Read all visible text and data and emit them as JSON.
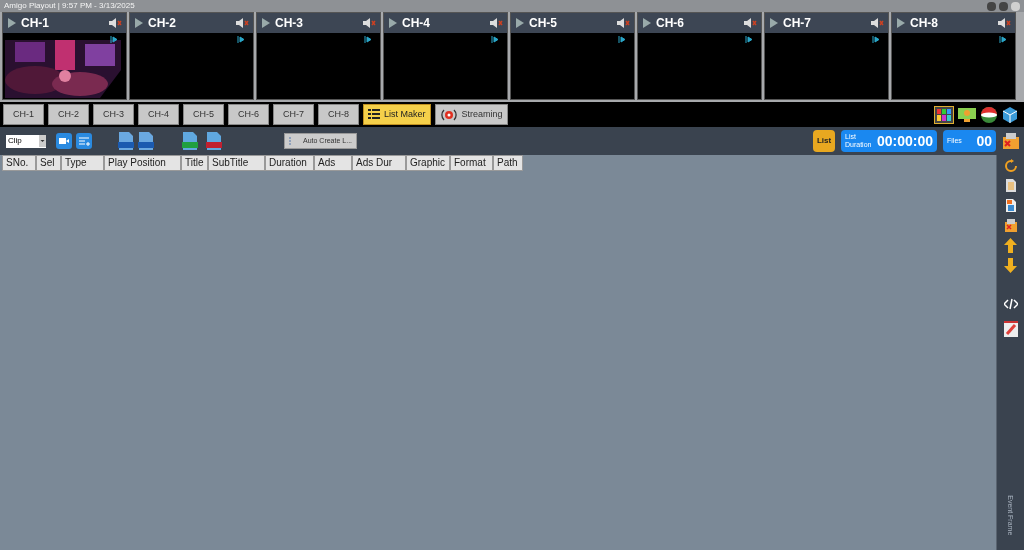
{
  "window": {
    "title": "Amigo Playout | 9:57 PM - 3/13/2025"
  },
  "channels": [
    {
      "label": "CH-1",
      "has_video": true
    },
    {
      "label": "CH-2",
      "has_video": false
    },
    {
      "label": "CH-3",
      "has_video": false
    },
    {
      "label": "CH-4",
      "has_video": false
    },
    {
      "label": "CH-5",
      "has_video": false
    },
    {
      "label": "CH-6",
      "has_video": false
    },
    {
      "label": "CH-7",
      "has_video": false
    },
    {
      "label": "CH-8",
      "has_video": false
    }
  ],
  "tabs": [
    {
      "label": "CH-1",
      "kind": "channel",
      "selected": false
    },
    {
      "label": "CH-2",
      "kind": "channel",
      "selected": false
    },
    {
      "label": "CH-3",
      "kind": "channel",
      "selected": false
    },
    {
      "label": "CH-4",
      "kind": "channel",
      "selected": false
    },
    {
      "label": "CH-5",
      "kind": "channel",
      "selected": false
    },
    {
      "label": "CH-6",
      "kind": "channel",
      "selected": false
    },
    {
      "label": "CH-7",
      "kind": "channel",
      "selected": false
    },
    {
      "label": "CH-8",
      "kind": "channel",
      "selected": false
    },
    {
      "label": "List Maker",
      "kind": "list",
      "selected": true
    },
    {
      "label": "Streaming",
      "kind": "stream",
      "selected": false
    }
  ],
  "toolbar": {
    "type_select": "Clip",
    "auto_create": "Auto Create L...",
    "list_button": "List",
    "duration_label": "List Duration",
    "duration": "00:00:00",
    "files_label": "Files",
    "files": "00"
  },
  "table": {
    "columns": [
      "SNo.",
      "Sel",
      "Type",
      "Play Position",
      "Title",
      "SubTitle",
      "Duration",
      "Ads",
      "Ads Dur",
      "Graphic",
      "Format",
      "Path"
    ]
  },
  "side_panel": {
    "label": "Event Frame"
  }
}
